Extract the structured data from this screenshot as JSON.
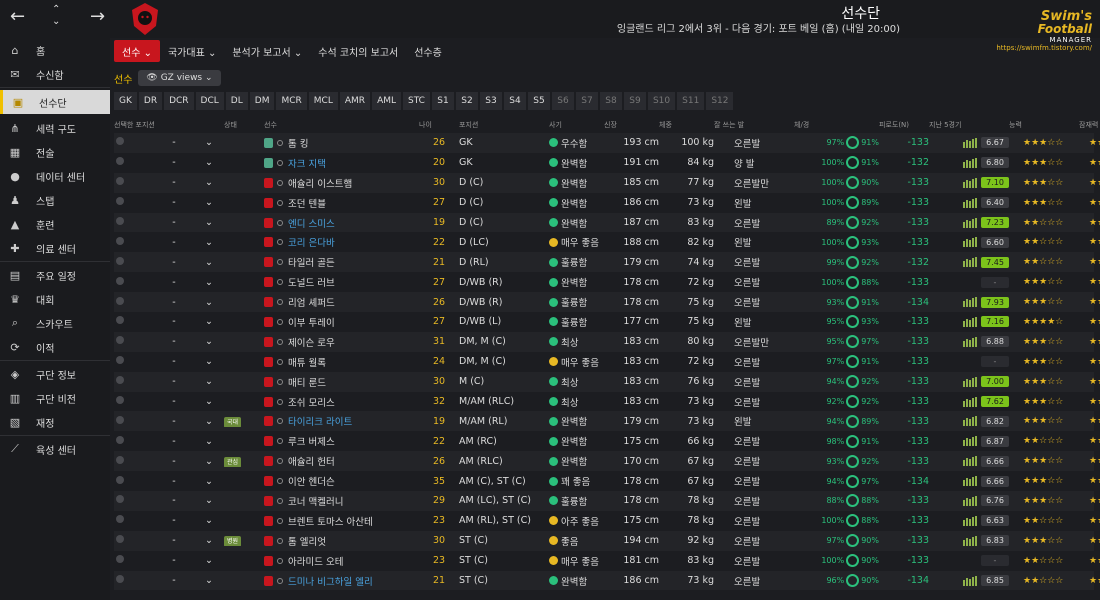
{
  "header": {
    "title": "선수단",
    "subtitle": "잉글랜드 리그 2에서 3위 - 다음 경기: 포트 베일 (홈) (내일 20:00)",
    "brand": {
      "line1": "Swim's",
      "line2": "Football",
      "line3": "MANAGER",
      "url": "https://swimfm.tistory.com/"
    }
  },
  "sidebar": {
    "items": [
      {
        "label": "홈",
        "icon": "home-icon"
      },
      {
        "label": "수신함",
        "icon": "inbox-icon"
      },
      {
        "label": "선수단",
        "icon": "shirt-icon",
        "active": true
      },
      {
        "label": "세력 구도",
        "icon": "hierarchy-icon"
      },
      {
        "label": "전술",
        "icon": "tactics-icon"
      },
      {
        "label": "데이터 센터",
        "icon": "data-icon"
      },
      {
        "label": "스탭",
        "icon": "staff-icon"
      },
      {
        "label": "훈련",
        "icon": "training-icon"
      },
      {
        "label": "의료 센터",
        "icon": "medical-icon"
      },
      {
        "label": "주요 일정",
        "icon": "calendar-icon"
      },
      {
        "label": "대회",
        "icon": "trophy-icon"
      },
      {
        "label": "스카우트",
        "icon": "scout-icon"
      },
      {
        "label": "이적",
        "icon": "transfer-icon"
      },
      {
        "label": "구단 정보",
        "icon": "club-info-icon"
      },
      {
        "label": "구단 비전",
        "icon": "vision-icon"
      },
      {
        "label": "재정",
        "icon": "finance-icon"
      },
      {
        "label": "육성 센터",
        "icon": "development-icon"
      }
    ]
  },
  "tabs": [
    "선수",
    "국가대표",
    "분석가 보고서",
    "수석 코치의 보고서",
    "선수층"
  ],
  "filter": {
    "label": "선수",
    "view": "GZ views"
  },
  "positions": [
    "GK",
    "DR",
    "DCR",
    "DCL",
    "DL",
    "DM",
    "MCR",
    "MCL",
    "AMR",
    "AML",
    "STC",
    "S1",
    "S2",
    "S3",
    "S4",
    "S5",
    "S6",
    "S7",
    "S8",
    "S9",
    "S10",
    "S11",
    "S12"
  ],
  "columns": [
    "선택한 포지션",
    "상태",
    "선수",
    "나이",
    "포지션",
    "사기",
    "신장",
    "체중",
    "잘 쓰는 발",
    "체/경",
    "피로도(N)",
    "지난 5경기",
    "능력",
    "잠재력"
  ],
  "players": [
    {
      "name": "톰 킹",
      "age": "26",
      "pos": "GK",
      "morale": "우수함",
      "height": "193 cm",
      "weight": "100 kg",
      "foot": "오른발",
      "fit": "97%",
      "cond": "91%",
      "sharp": "-133",
      "last5": "6.67",
      "rhi": false,
      "abil": "★★★☆☆",
      "pot": "★★★★☆",
      "gk": true,
      "link": false,
      "tag": ""
    },
    {
      "name": "자크 지택",
      "age": "20",
      "pos": "GK",
      "morale": "완벽함",
      "height": "191 cm",
      "weight": "84 kg",
      "foot": "양 발",
      "fit": "100%",
      "cond": "91%",
      "sharp": "-132",
      "last5": "6.80",
      "rhi": false,
      "abil": "★★★☆☆",
      "pot": "★★★★☆",
      "gk": true,
      "link": true,
      "tag": ""
    },
    {
      "name": "애슐리 이스트햄",
      "age": "30",
      "pos": "D (C)",
      "morale": "완벽함",
      "height": "185 cm",
      "weight": "77 kg",
      "foot": "오른발만",
      "fit": "100%",
      "cond": "90%",
      "sharp": "-133",
      "last5": "7.10",
      "rhi": true,
      "abil": "★★★☆☆",
      "pot": "★★★☆☆",
      "gk": false,
      "link": false,
      "tag": ""
    },
    {
      "name": "조던 텐블",
      "age": "27",
      "pos": "D (C)",
      "morale": "완벽함",
      "height": "186 cm",
      "weight": "73 kg",
      "foot": "왼발",
      "fit": "100%",
      "cond": "89%",
      "sharp": "-133",
      "last5": "6.40",
      "rhi": false,
      "abil": "★★★☆☆",
      "pot": "★★★☆☆",
      "gk": false,
      "link": false,
      "tag": ""
    },
    {
      "name": "엔디 스미스",
      "age": "19",
      "pos": "D (C)",
      "morale": "완벽함",
      "height": "187 cm",
      "weight": "83 kg",
      "foot": "오른발",
      "fit": "89%",
      "cond": "92%",
      "sharp": "-133",
      "last5": "7.23",
      "rhi": true,
      "abil": "★★☆☆☆",
      "pot": "★★★★☆",
      "gk": false,
      "link": true,
      "tag": ""
    },
    {
      "name": "코리 은다바",
      "age": "22",
      "pos": "D (LC)",
      "morale": "매우 좋음",
      "height": "188 cm",
      "weight": "82 kg",
      "foot": "왼발",
      "fit": "100%",
      "cond": "93%",
      "sharp": "-133",
      "last5": "6.60",
      "rhi": false,
      "abil": "★★☆☆☆",
      "pot": "★★★★☆",
      "gk": false,
      "link": true,
      "tag": ""
    },
    {
      "name": "타일러 골든",
      "age": "21",
      "pos": "D (RL)",
      "morale": "훌륭함",
      "height": "179 cm",
      "weight": "74 kg",
      "foot": "오른발",
      "fit": "99%",
      "cond": "92%",
      "sharp": "-132",
      "last5": "7.45",
      "rhi": true,
      "abil": "★★☆☆☆",
      "pot": "★★★☆☆",
      "gk": false,
      "link": false,
      "tag": ""
    },
    {
      "name": "도널드 러브",
      "age": "27",
      "pos": "D/WB (R)",
      "morale": "완벽함",
      "height": "178 cm",
      "weight": "72 kg",
      "foot": "오른발",
      "fit": "100%",
      "cond": "88%",
      "sharp": "-133",
      "last5": "-",
      "rhi": false,
      "abil": "★★★☆☆",
      "pot": "★★★☆☆",
      "gk": false,
      "link": false,
      "tag": ""
    },
    {
      "name": "리엄 셰퍼드",
      "age": "26",
      "pos": "D/WB (R)",
      "morale": "훌륭함",
      "height": "178 cm",
      "weight": "75 kg",
      "foot": "오른발",
      "fit": "93%",
      "cond": "91%",
      "sharp": "-134",
      "last5": "7.93",
      "rhi": true,
      "abil": "★★★☆☆",
      "pot": "★★★☆☆",
      "gk": false,
      "link": false,
      "tag": ""
    },
    {
      "name": "이부 투레이",
      "age": "27",
      "pos": "D/WB (L)",
      "morale": "훌륭함",
      "height": "177 cm",
      "weight": "75 kg",
      "foot": "왼발",
      "fit": "95%",
      "cond": "93%",
      "sharp": "-133",
      "last5": "7.16",
      "rhi": true,
      "abil": "★★★★☆",
      "pot": "★★★★☆",
      "gk": false,
      "link": false,
      "tag": ""
    },
    {
      "name": "제이슨 로우",
      "age": "31",
      "pos": "DM, M (C)",
      "morale": "최상",
      "height": "183 cm",
      "weight": "80 kg",
      "foot": "오른발만",
      "fit": "95%",
      "cond": "97%",
      "sharp": "-133",
      "last5": "6.88",
      "rhi": false,
      "abil": "★★★☆☆",
      "pot": "★★★☆☆",
      "gk": false,
      "link": false,
      "tag": ""
    },
    {
      "name": "매튜 월록",
      "age": "24",
      "pos": "DM, M (C)",
      "morale": "매우 좋음",
      "height": "183 cm",
      "weight": "72 kg",
      "foot": "오른발",
      "fit": "97%",
      "cond": "91%",
      "sharp": "-133",
      "last5": "-",
      "rhi": false,
      "abil": "★★★☆☆",
      "pot": "★★★☆☆",
      "gk": false,
      "link": false,
      "tag": ""
    },
    {
      "name": "매티 룬드",
      "age": "30",
      "pos": "M (C)",
      "morale": "최상",
      "height": "183 cm",
      "weight": "76 kg",
      "foot": "오른발",
      "fit": "94%",
      "cond": "92%",
      "sharp": "-133",
      "last5": "7.00",
      "rhi": true,
      "abil": "★★★☆☆",
      "pot": "★★★☆☆",
      "gk": false,
      "link": false,
      "tag": ""
    },
    {
      "name": "조쉬 모리스",
      "age": "32",
      "pos": "M/AM (RLC)",
      "morale": "최상",
      "height": "183 cm",
      "weight": "73 kg",
      "foot": "오른발",
      "fit": "92%",
      "cond": "92%",
      "sharp": "-133",
      "last5": "7.62",
      "rhi": true,
      "abil": "★★★☆☆",
      "pot": "★★★☆☆",
      "gk": false,
      "link": false,
      "tag": ""
    },
    {
      "name": "타이리크 라이트",
      "age": "19",
      "pos": "M/AM (RL)",
      "morale": "완벽함",
      "height": "179 cm",
      "weight": "73 kg",
      "foot": "왼발",
      "fit": "94%",
      "cond": "89%",
      "sharp": "-133",
      "last5": "6.82",
      "rhi": false,
      "abil": "★★★☆☆",
      "pot": "★★★★★",
      "gk": false,
      "link": true,
      "tag": "국대"
    },
    {
      "name": "루크 버제스",
      "age": "22",
      "pos": "AM (RC)",
      "morale": "완벽함",
      "height": "175 cm",
      "weight": "66 kg",
      "foot": "오른발",
      "fit": "98%",
      "cond": "91%",
      "sharp": "-133",
      "last5": "6.87",
      "rhi": false,
      "abil": "★★☆☆☆",
      "pot": "★★★☆☆",
      "gk": false,
      "link": false,
      "tag": ""
    },
    {
      "name": "애슐리 헌터",
      "age": "26",
      "pos": "AM (RLC)",
      "morale": "완벽함",
      "height": "170 cm",
      "weight": "67 kg",
      "foot": "오른발",
      "fit": "93%",
      "cond": "92%",
      "sharp": "-133",
      "last5": "6.66",
      "rhi": false,
      "abil": "★★★☆☆",
      "pot": "★★★☆☆",
      "gk": false,
      "link": false,
      "tag": "관심"
    },
    {
      "name": "이안 헨더슨",
      "age": "35",
      "pos": "AM (C), ST (C)",
      "morale": "꽤 좋음",
      "height": "178 cm",
      "weight": "67 kg",
      "foot": "오른발",
      "fit": "94%",
      "cond": "97%",
      "sharp": "-134",
      "last5": "6.66",
      "rhi": false,
      "abil": "★★★☆☆",
      "pot": "★★★☆☆",
      "gk": false,
      "link": false,
      "tag": ""
    },
    {
      "name": "코너 맥켈러니",
      "age": "29",
      "pos": "AM (LC), ST (C)",
      "morale": "훌륭함",
      "height": "178 cm",
      "weight": "78 kg",
      "foot": "오른발",
      "fit": "88%",
      "cond": "88%",
      "sharp": "-133",
      "last5": "6.76",
      "rhi": false,
      "abil": "★★★☆☆",
      "pot": "★★★☆☆",
      "gk": false,
      "link": false,
      "tag": ""
    },
    {
      "name": "브렌트 토마스 아산테",
      "age": "23",
      "pos": "AM (RL), ST (C)",
      "morale": "아주 좋음",
      "height": "175 cm",
      "weight": "78 kg",
      "foot": "오른발",
      "fit": "100%",
      "cond": "88%",
      "sharp": "-133",
      "last5": "6.63",
      "rhi": false,
      "abil": "★★☆☆☆",
      "pot": "★★★★☆",
      "gk": false,
      "link": false,
      "tag": ""
    },
    {
      "name": "톰 엘리엇",
      "age": "30",
      "pos": "ST (C)",
      "morale": "좋음",
      "height": "194 cm",
      "weight": "92 kg",
      "foot": "오른발",
      "fit": "97%",
      "cond": "90%",
      "sharp": "-133",
      "last5": "6.83",
      "rhi": false,
      "abil": "★★★☆☆",
      "pot": "★★★☆☆",
      "gk": false,
      "link": false,
      "tag": "병원"
    },
    {
      "name": "아라미드 오테",
      "age": "23",
      "pos": "ST (C)",
      "morale": "매우 좋음",
      "height": "181 cm",
      "weight": "83 kg",
      "foot": "오른발",
      "fit": "100%",
      "cond": "90%",
      "sharp": "-133",
      "last5": "-",
      "rhi": false,
      "abil": "★★☆☆☆",
      "pot": "★★★☆☆",
      "gk": false,
      "link": false,
      "tag": ""
    },
    {
      "name": "드미나 비그하일 엘리",
      "age": "21",
      "pos": "ST (C)",
      "morale": "완벽함",
      "height": "186 cm",
      "weight": "73 kg",
      "foot": "오른발",
      "fit": "96%",
      "cond": "90%",
      "sharp": "-134",
      "last5": "6.85",
      "rhi": false,
      "abil": "★★☆☆☆",
      "pot": "★★★★☆",
      "gk": false,
      "link": true,
      "tag": ""
    }
  ]
}
